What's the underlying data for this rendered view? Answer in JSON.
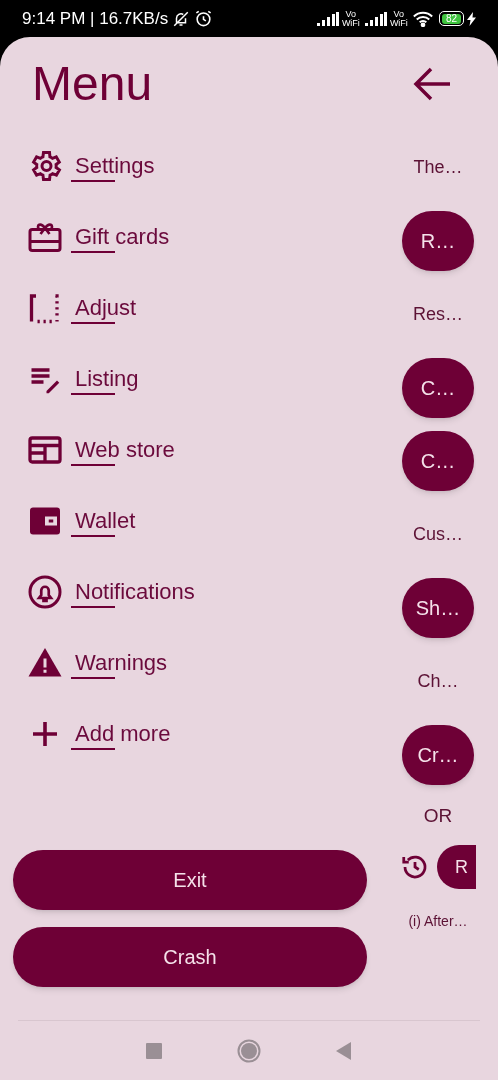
{
  "status_bar": {
    "time": "9:14 PM | 16.7KB/s",
    "network_labels": [
      {
        "top": "Vo",
        "bottom": "WiFi"
      },
      {
        "top": "Vo",
        "bottom": "WiFi"
      }
    ],
    "battery": "82"
  },
  "header": {
    "title": "Menu"
  },
  "menu": [
    {
      "label": "Settings"
    },
    {
      "label": "Gift cards"
    },
    {
      "label": "Adjust"
    },
    {
      "label": "Listing"
    },
    {
      "label": "Web store"
    },
    {
      "label": "Wallet"
    },
    {
      "label": "Notifications"
    },
    {
      "label": "Warnings"
    },
    {
      "label": "Add more"
    }
  ],
  "side_panel": [
    {
      "kind": "label",
      "text": "The…"
    },
    {
      "kind": "button",
      "text": "R…"
    },
    {
      "kind": "label",
      "text": "Res…"
    },
    {
      "kind": "button",
      "text": "C…"
    },
    {
      "kind": "button",
      "text": "C…"
    },
    {
      "kind": "label",
      "text": "Cus…"
    },
    {
      "kind": "button",
      "text": "Sh…"
    },
    {
      "kind": "label",
      "text": "Ch…"
    },
    {
      "kind": "button",
      "text": "Cr…"
    },
    {
      "kind": "divider",
      "text": "OR"
    },
    {
      "kind": "history_button",
      "text": "R"
    },
    {
      "kind": "note",
      "text": "(i) After…"
    }
  ],
  "buttons": [
    {
      "label": "Exit"
    },
    {
      "label": "Crash"
    }
  ]
}
